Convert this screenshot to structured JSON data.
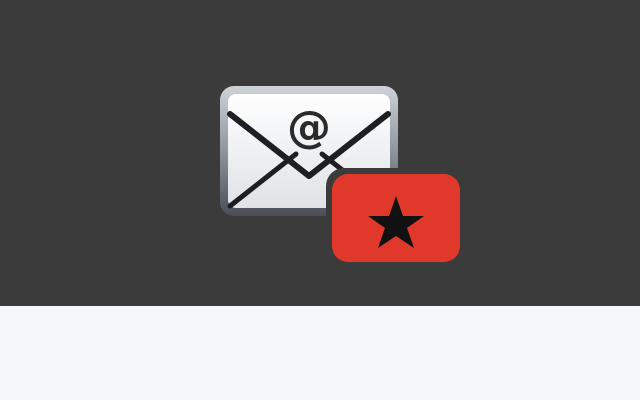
{
  "colors": {
    "header_background": "#3b3b3b",
    "content_background": "#f6f7f9",
    "badge_red": "#e0392b",
    "star": "#111111"
  },
  "app_icon": {
    "mail_icon": "envelope-at-icon",
    "mail_symbol": "@",
    "badge_icon": "star-icon"
  }
}
